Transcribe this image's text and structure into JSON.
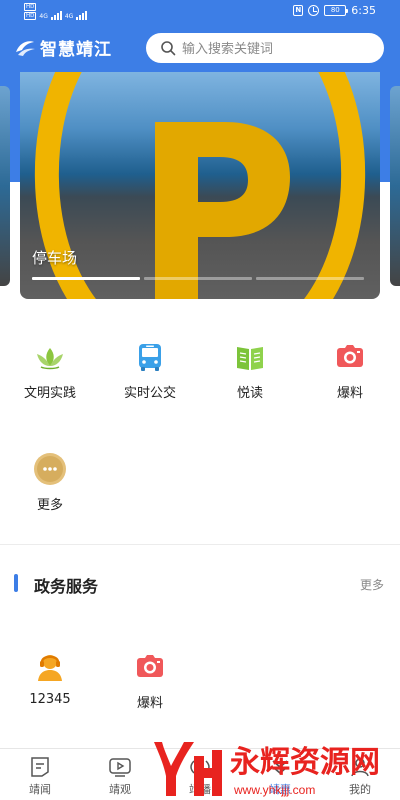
{
  "status_bar": {
    "sim1": "HD",
    "sim2": "HD",
    "network1": "4G",
    "network2": "4G",
    "nfc": "N",
    "battery": "80",
    "time": "6:35"
  },
  "header": {
    "app_name": "智慧靖江",
    "search_placeholder": "输入搜索关键词"
  },
  "carousel": {
    "caption": "停车场",
    "slide_count": 3,
    "active_index": 0
  },
  "quick_links": [
    {
      "label": "文明实践",
      "icon": "lotus-icon"
    },
    {
      "label": "实时公交",
      "icon": "bus-icon"
    },
    {
      "label": "悦读",
      "icon": "book-icon"
    },
    {
      "label": "爆料",
      "icon": "camera-icon"
    },
    {
      "label": "更多",
      "icon": "more-icon"
    }
  ],
  "gov_section": {
    "title": "政务服务",
    "more": "更多",
    "items": [
      {
        "label": "12345",
        "icon": "headset-operator-icon"
      },
      {
        "label": "爆料",
        "icon": "camera-icon"
      }
    ]
  },
  "tabbar": {
    "items": [
      {
        "label": "靖闻",
        "icon": "news-icon"
      },
      {
        "label": "靖观",
        "icon": "video-icon"
      },
      {
        "label": "靖播",
        "icon": "broadcast-icon"
      },
      {
        "label": "靖惠",
        "icon": "service-icon"
      },
      {
        "label": "我的",
        "icon": "profile-icon"
      }
    ],
    "active_index": 3
  },
  "watermark": {
    "brand": "永辉资源网",
    "url": "www.yhkjjj.com"
  },
  "colors": {
    "primary": "#3d7ee6",
    "parking_yellow": "#f0b400",
    "camera_red": "#f0585a",
    "bus_blue": "#3aa0e8",
    "book_green": "#7cc43a",
    "more_gold": "#d8b366",
    "watermark_red": "#e8231f"
  }
}
